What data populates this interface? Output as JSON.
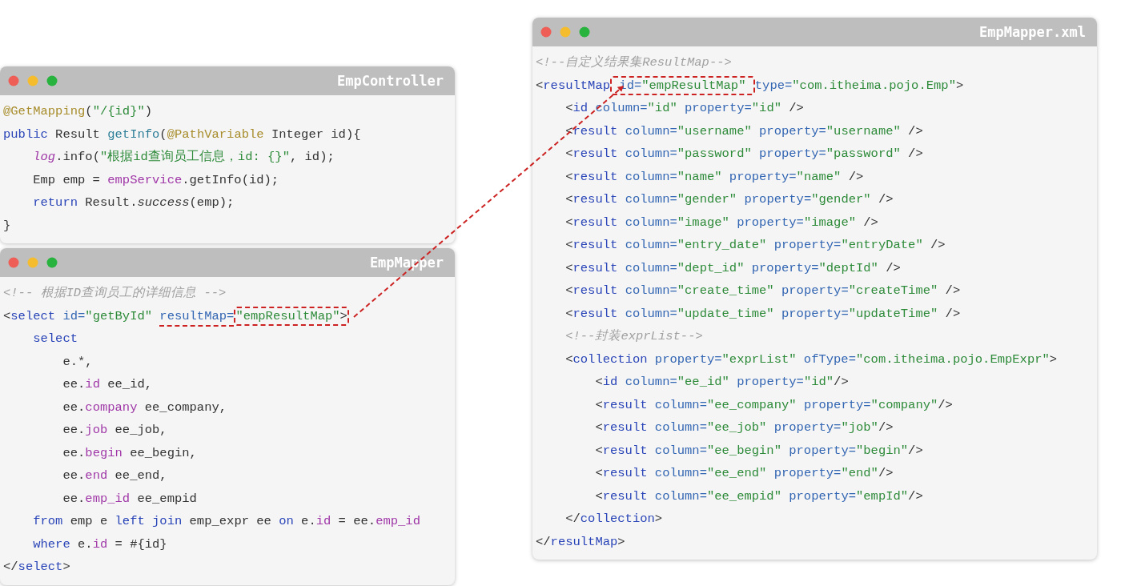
{
  "windows": [
    {
      "title": "EmpController",
      "lines": [
        [
          {
            "kind": "an",
            "text": "@GetMapping"
          },
          {
            "kind": "p",
            "text": "("
          },
          {
            "kind": "s",
            "text": "\"/{id}\""
          },
          {
            "kind": "p",
            "text": ")"
          }
        ],
        [
          {
            "kind": "kw",
            "text": "public"
          },
          {
            "kind": "p",
            "text": " Result "
          },
          {
            "kind": "fn",
            "text": "getInfo"
          },
          {
            "kind": "p",
            "text": "("
          },
          {
            "kind": "an",
            "text": "@PathVariable"
          },
          {
            "kind": "p",
            "text": " Integer id){"
          }
        ],
        [
          {
            "kind": "fi",
            "text": "    log"
          },
          {
            "kind": "p",
            "text": ".info("
          },
          {
            "kind": "s",
            "text": "\"根据id查询员工信息，id: {}\""
          },
          {
            "kind": "p",
            "text": ", id);"
          }
        ],
        [
          {
            "kind": "p",
            "text": "    Emp emp = "
          },
          {
            "kind": "f",
            "text": "empService"
          },
          {
            "kind": "p",
            "text": ".getInfo(id);"
          }
        ],
        [
          {
            "kind": "kw",
            "text": "    return"
          },
          {
            "kind": "p",
            "text": " Result."
          },
          {
            "kind": "it",
            "text": "success"
          },
          {
            "kind": "p",
            "text": "(emp);"
          }
        ],
        [
          {
            "kind": "p",
            "text": "}"
          }
        ]
      ]
    },
    {
      "title": "EmpMapper",
      "lines": [
        [
          {
            "kind": "c",
            "text": "<!-- 根据ID查询员工的详细信息 -->"
          }
        ],
        [
          {
            "kind": "p",
            "text": "<"
          },
          {
            "kind": "kw",
            "text": "select"
          },
          {
            "kind": "at",
            "text": " id="
          },
          {
            "kind": "s",
            "text": "\"getById\" "
          },
          {
            "kind": "at",
            "text": "resultMap=",
            "underlined": true
          },
          {
            "kind": "s",
            "text": "\"empResultMap\"",
            "boxed": true
          },
          {
            "kind": "p",
            "text": ">",
            "boxed": true
          }
        ],
        [
          {
            "kind": "kw",
            "text": "    select"
          }
        ],
        [
          {
            "kind": "p",
            "text": "        e.*,"
          }
        ],
        [
          {
            "kind": "p",
            "text": "        ee."
          },
          {
            "kind": "f",
            "text": "id"
          },
          {
            "kind": "p",
            "text": " ee_id,"
          }
        ],
        [
          {
            "kind": "p",
            "text": "        ee."
          },
          {
            "kind": "f",
            "text": "company"
          },
          {
            "kind": "p",
            "text": " ee_company,"
          }
        ],
        [
          {
            "kind": "p",
            "text": "        ee."
          },
          {
            "kind": "f",
            "text": "job"
          },
          {
            "kind": "p",
            "text": " ee_job,"
          }
        ],
        [
          {
            "kind": "p",
            "text": "        ee."
          },
          {
            "kind": "f",
            "text": "begin"
          },
          {
            "kind": "p",
            "text": " ee_begin,"
          }
        ],
        [
          {
            "kind": "p",
            "text": "        ee."
          },
          {
            "kind": "f",
            "text": "end"
          },
          {
            "kind": "p",
            "text": " ee_end,"
          }
        ],
        [
          {
            "kind": "p",
            "text": "        ee."
          },
          {
            "kind": "f",
            "text": "emp_id"
          },
          {
            "kind": "p",
            "text": " ee_empid"
          }
        ],
        [
          {
            "kind": "kw",
            "text": "    from"
          },
          {
            "kind": "p",
            "text": " emp e "
          },
          {
            "kind": "kw",
            "text": "left join"
          },
          {
            "kind": "p",
            "text": " emp_expr ee "
          },
          {
            "kind": "kw",
            "text": "on"
          },
          {
            "kind": "p",
            "text": " e."
          },
          {
            "kind": "f",
            "text": "id"
          },
          {
            "kind": "p",
            "text": " = ee."
          },
          {
            "kind": "f",
            "text": "emp_id"
          }
        ],
        [
          {
            "kind": "kw",
            "text": "    where"
          },
          {
            "kind": "p",
            "text": " e."
          },
          {
            "kind": "f",
            "text": "id"
          },
          {
            "kind": "p",
            "text": " = #{id}"
          }
        ],
        [
          {
            "kind": "p",
            "text": "</"
          },
          {
            "kind": "kw",
            "text": "select"
          },
          {
            "kind": "p",
            "text": ">"
          }
        ]
      ]
    },
    {
      "title": "EmpMapper.xml",
      "lines": [
        [
          {
            "kind": "c",
            "text": "<!--自定义结果集ResultMap-->"
          }
        ],
        [
          {
            "kind": "p",
            "text": "<"
          },
          {
            "kind": "kw",
            "text": "resultMap"
          },
          {
            "kind": "at",
            "text": " id=",
            "boxed": true
          },
          {
            "kind": "s",
            "text": "\"empResultMap\" ",
            "boxed": true
          },
          {
            "kind": "at",
            "text": "type="
          },
          {
            "kind": "s",
            "text": "\"com.itheima.pojo.Emp\""
          },
          {
            "kind": "p",
            "text": ">"
          }
        ],
        [
          {
            "kind": "p",
            "text": "    <"
          },
          {
            "kind": "kw",
            "text": "id"
          },
          {
            "kind": "at",
            "text": " column="
          },
          {
            "kind": "s",
            "text": "\"id\""
          },
          {
            "kind": "at",
            "text": " property="
          },
          {
            "kind": "s",
            "text": "\"id\""
          },
          {
            "kind": "p",
            "text": " />"
          }
        ],
        [
          {
            "kind": "p",
            "text": "    <"
          },
          {
            "kind": "kw",
            "text": "result"
          },
          {
            "kind": "at",
            "text": " column="
          },
          {
            "kind": "s",
            "text": "\"username\""
          },
          {
            "kind": "at",
            "text": " property="
          },
          {
            "kind": "s",
            "text": "\"username\""
          },
          {
            "kind": "p",
            "text": " />"
          }
        ],
        [
          {
            "kind": "p",
            "text": "    <"
          },
          {
            "kind": "kw",
            "text": "result"
          },
          {
            "kind": "at",
            "text": " column="
          },
          {
            "kind": "s",
            "text": "\"password\""
          },
          {
            "kind": "at",
            "text": " property="
          },
          {
            "kind": "s",
            "text": "\"password\""
          },
          {
            "kind": "p",
            "text": " />"
          }
        ],
        [
          {
            "kind": "p",
            "text": "    <"
          },
          {
            "kind": "kw",
            "text": "result"
          },
          {
            "kind": "at",
            "text": " column="
          },
          {
            "kind": "s",
            "text": "\"name\""
          },
          {
            "kind": "at",
            "text": " property="
          },
          {
            "kind": "s",
            "text": "\"name\""
          },
          {
            "kind": "p",
            "text": " />"
          }
        ],
        [
          {
            "kind": "p",
            "text": "    <"
          },
          {
            "kind": "kw",
            "text": "result"
          },
          {
            "kind": "at",
            "text": " column="
          },
          {
            "kind": "s",
            "text": "\"gender\""
          },
          {
            "kind": "at",
            "text": " property="
          },
          {
            "kind": "s",
            "text": "\"gender\""
          },
          {
            "kind": "p",
            "text": " />"
          }
        ],
        [
          {
            "kind": "p",
            "text": "    <"
          },
          {
            "kind": "kw",
            "text": "result"
          },
          {
            "kind": "at",
            "text": " column="
          },
          {
            "kind": "s",
            "text": "\"image\""
          },
          {
            "kind": "at",
            "text": " property="
          },
          {
            "kind": "s",
            "text": "\"image\""
          },
          {
            "kind": "p",
            "text": " />"
          }
        ],
        [
          {
            "kind": "p",
            "text": "    <"
          },
          {
            "kind": "kw",
            "text": "result"
          },
          {
            "kind": "at",
            "text": " column="
          },
          {
            "kind": "s",
            "text": "\"entry_date\""
          },
          {
            "kind": "at",
            "text": " property="
          },
          {
            "kind": "s",
            "text": "\"entryDate\""
          },
          {
            "kind": "p",
            "text": " />"
          }
        ],
        [
          {
            "kind": "p",
            "text": "    <"
          },
          {
            "kind": "kw",
            "text": "result"
          },
          {
            "kind": "at",
            "text": " column="
          },
          {
            "kind": "s",
            "text": "\"dept_id\""
          },
          {
            "kind": "at",
            "text": " property="
          },
          {
            "kind": "s",
            "text": "\"deptId\""
          },
          {
            "kind": "p",
            "text": " />"
          }
        ],
        [
          {
            "kind": "p",
            "text": "    <"
          },
          {
            "kind": "kw",
            "text": "result"
          },
          {
            "kind": "at",
            "text": " column="
          },
          {
            "kind": "s",
            "text": "\"create_time\""
          },
          {
            "kind": "at",
            "text": " property="
          },
          {
            "kind": "s",
            "text": "\"createTime\""
          },
          {
            "kind": "p",
            "text": " />"
          }
        ],
        [
          {
            "kind": "p",
            "text": "    <"
          },
          {
            "kind": "kw",
            "text": "result"
          },
          {
            "kind": "at",
            "text": " column="
          },
          {
            "kind": "s",
            "text": "\"update_time\""
          },
          {
            "kind": "at",
            "text": " property="
          },
          {
            "kind": "s",
            "text": "\"updateTime\""
          },
          {
            "kind": "p",
            "text": " />"
          }
        ],
        [
          {
            "kind": "c",
            "text": "    <!--封装exprList-->"
          }
        ],
        [
          {
            "kind": "p",
            "text": "    <"
          },
          {
            "kind": "kw",
            "text": "collection"
          },
          {
            "kind": "at",
            "text": " property="
          },
          {
            "kind": "s",
            "text": "\"exprList\""
          },
          {
            "kind": "at",
            "text": " ofType="
          },
          {
            "kind": "s",
            "text": "\"com.itheima.pojo.EmpExpr\""
          },
          {
            "kind": "p",
            "text": ">"
          }
        ],
        [
          {
            "kind": "p",
            "text": "        <"
          },
          {
            "kind": "kw",
            "text": "id"
          },
          {
            "kind": "at",
            "text": " column="
          },
          {
            "kind": "s",
            "text": "\"ee_id\""
          },
          {
            "kind": "at",
            "text": " property="
          },
          {
            "kind": "s",
            "text": "\"id\""
          },
          {
            "kind": "p",
            "text": "/>"
          }
        ],
        [
          {
            "kind": "p",
            "text": "        <"
          },
          {
            "kind": "kw",
            "text": "result"
          },
          {
            "kind": "at",
            "text": " column="
          },
          {
            "kind": "s",
            "text": "\"ee_company\""
          },
          {
            "kind": "at",
            "text": " property="
          },
          {
            "kind": "s",
            "text": "\"company\""
          },
          {
            "kind": "p",
            "text": "/>"
          }
        ],
        [
          {
            "kind": "p",
            "text": "        <"
          },
          {
            "kind": "kw",
            "text": "result"
          },
          {
            "kind": "at",
            "text": " column="
          },
          {
            "kind": "s",
            "text": "\"ee_job\""
          },
          {
            "kind": "at",
            "text": " property="
          },
          {
            "kind": "s",
            "text": "\"job\""
          },
          {
            "kind": "p",
            "text": "/>"
          }
        ],
        [
          {
            "kind": "p",
            "text": "        <"
          },
          {
            "kind": "kw",
            "text": "result"
          },
          {
            "kind": "at",
            "text": " column="
          },
          {
            "kind": "s",
            "text": "\"ee_begin\""
          },
          {
            "kind": "at",
            "text": " property="
          },
          {
            "kind": "s",
            "text": "\"begin\""
          },
          {
            "kind": "p",
            "text": "/>"
          }
        ],
        [
          {
            "kind": "p",
            "text": "        <"
          },
          {
            "kind": "kw",
            "text": "result"
          },
          {
            "kind": "at",
            "text": " column="
          },
          {
            "kind": "s",
            "text": "\"ee_end\""
          },
          {
            "kind": "at",
            "text": " property="
          },
          {
            "kind": "s",
            "text": "\"end\""
          },
          {
            "kind": "p",
            "text": "/>"
          }
        ],
        [
          {
            "kind": "p",
            "text": "        <"
          },
          {
            "kind": "kw",
            "text": "result"
          },
          {
            "kind": "at",
            "text": " column="
          },
          {
            "kind": "s",
            "text": "\"ee_empid\""
          },
          {
            "kind": "at",
            "text": " property="
          },
          {
            "kind": "s",
            "text": "\"empId\""
          },
          {
            "kind": "p",
            "text": "/>"
          }
        ],
        [
          {
            "kind": "p",
            "text": "    </"
          },
          {
            "kind": "kw",
            "text": "collection"
          },
          {
            "kind": "p",
            "text": ">"
          }
        ],
        [
          {
            "kind": "p",
            "text": "</"
          },
          {
            "kind": "kw",
            "text": "resultMap"
          },
          {
            "kind": "p",
            "text": ">"
          }
        ]
      ]
    }
  ]
}
